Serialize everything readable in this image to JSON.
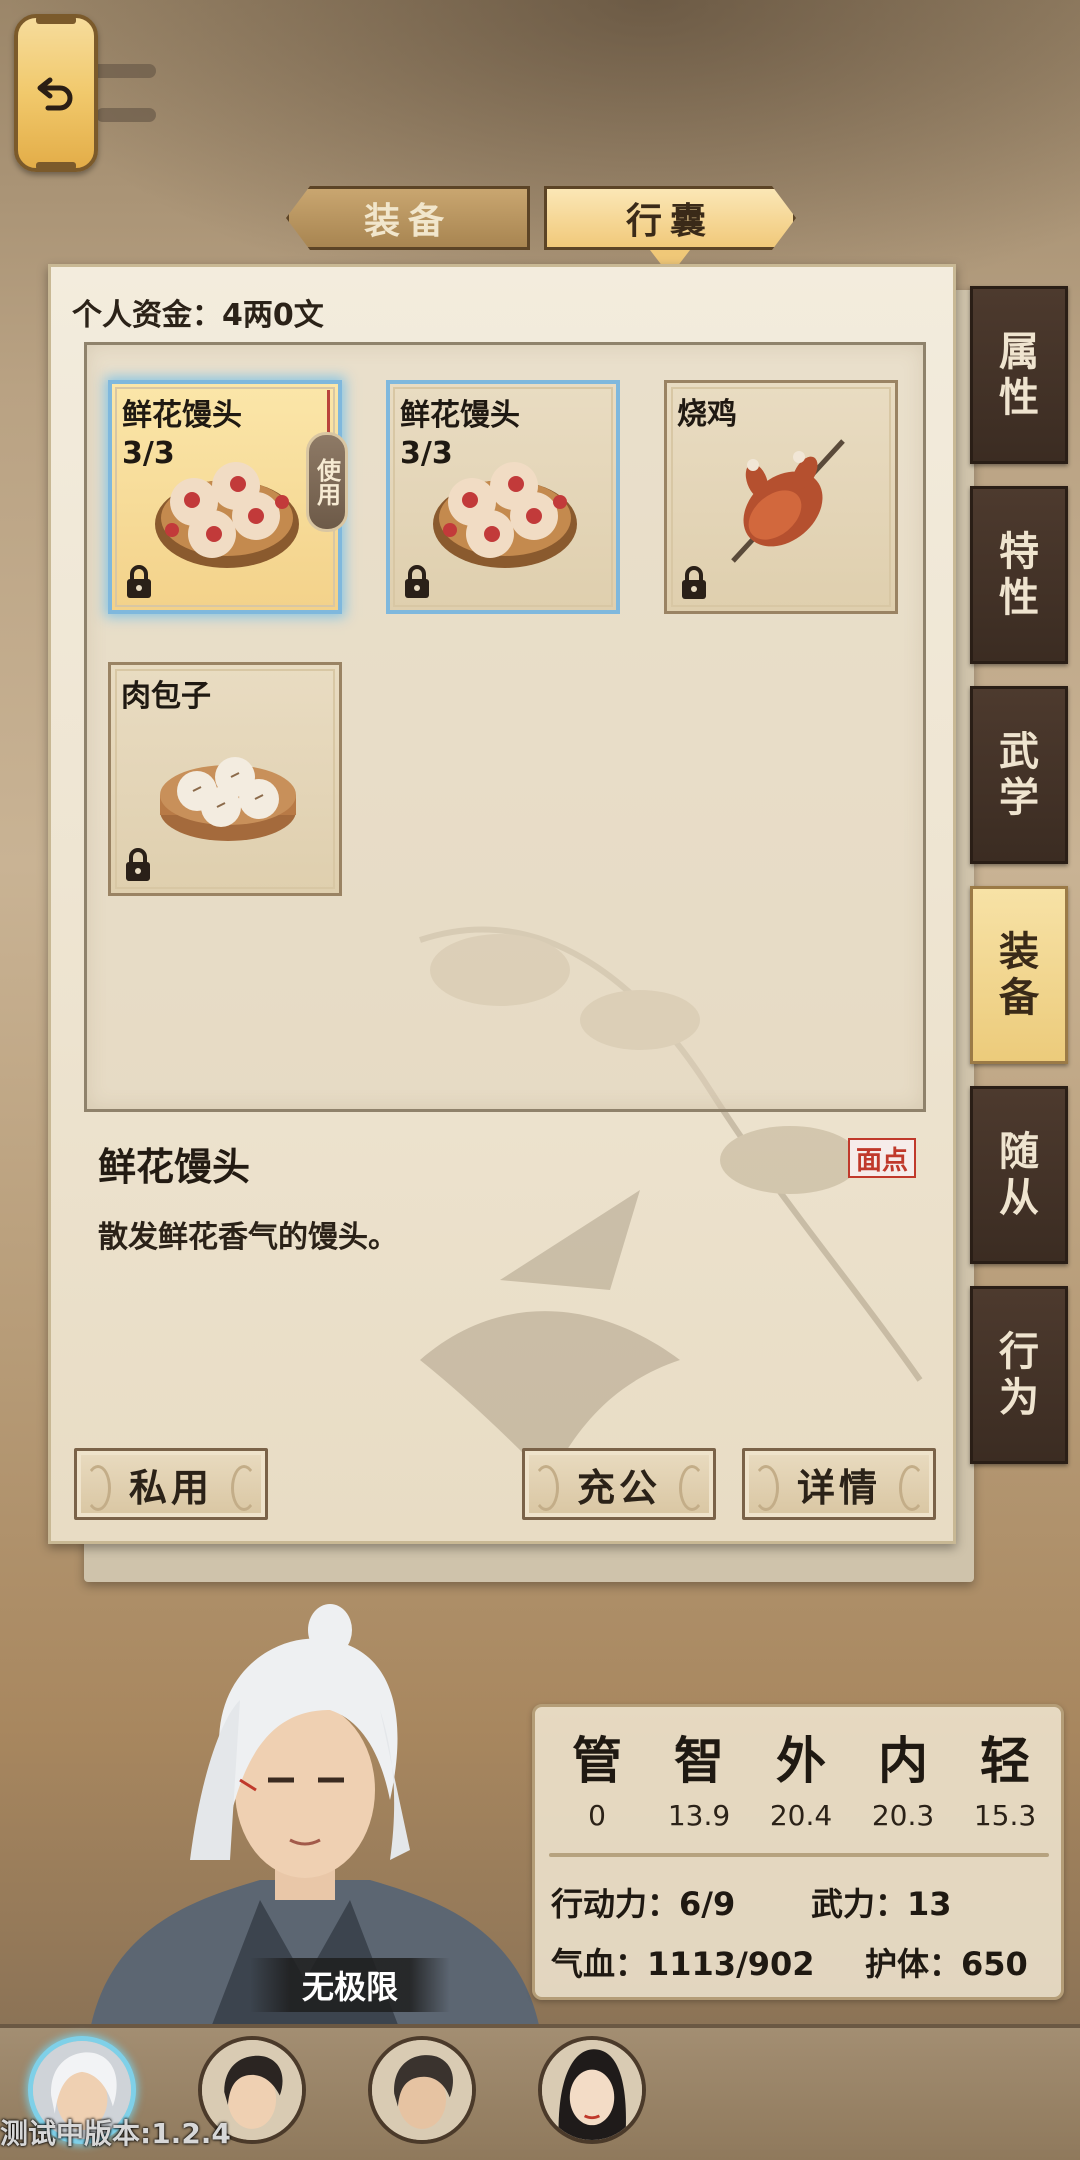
{
  "header": {
    "tabs": [
      {
        "label": "装备",
        "active": false
      },
      {
        "label": "行囊",
        "active": true
      }
    ]
  },
  "panel": {
    "money_label": "个人资金：4两0文",
    "items": [
      {
        "name": "鲜花馒头",
        "qty": "3/3",
        "selected": true,
        "action": "使用",
        "icon": "flower-bun-icon"
      },
      {
        "name": "鲜花馒头",
        "qty": "3/3",
        "selected": false,
        "icon": "flower-bun-icon"
      },
      {
        "name": "烧鸡",
        "qty": "",
        "selected": false,
        "icon": "roast-chicken-icon"
      },
      {
        "name": "肉包子",
        "qty": "",
        "selected": false,
        "icon": "meat-bun-icon"
      }
    ],
    "detail": {
      "name": "鲜花馒头",
      "type": "面点",
      "description": "散发鲜花香气的馒头。"
    },
    "buttons": {
      "private_use": "私用",
      "donate": "充公",
      "details": "详情"
    }
  },
  "side_tabs": [
    {
      "label": [
        "属",
        "性"
      ],
      "active": false
    },
    {
      "label": [
        "特",
        "性"
      ],
      "active": false
    },
    {
      "label": [
        "武",
        "学"
      ],
      "active": false
    },
    {
      "label": [
        "装",
        "备"
      ],
      "active": true
    },
    {
      "label": [
        "随",
        "从"
      ],
      "active": false
    },
    {
      "label": [
        "行",
        "为"
      ],
      "active": false
    }
  ],
  "stats": {
    "attributes": [
      {
        "glyph": "管",
        "value": "0"
      },
      {
        "glyph": "智",
        "value": "13.9"
      },
      {
        "glyph": "外",
        "value": "20.4"
      },
      {
        "glyph": "内",
        "value": "20.3"
      },
      {
        "glyph": "轻",
        "value": "15.3"
      }
    ],
    "action_points": "行动力：6/9",
    "force": "武力：13",
    "hp": "气血：1113/902",
    "armor": "护体：650"
  },
  "character": {
    "name": "无极限"
  },
  "footer": {
    "version": "测试中版本:1.2.4"
  },
  "colors": {
    "accent_gold": "#f1c97a",
    "selection_blue": "#7fb8dd",
    "tag_red": "#c0392b",
    "dark_tab": "#3b2c22"
  }
}
